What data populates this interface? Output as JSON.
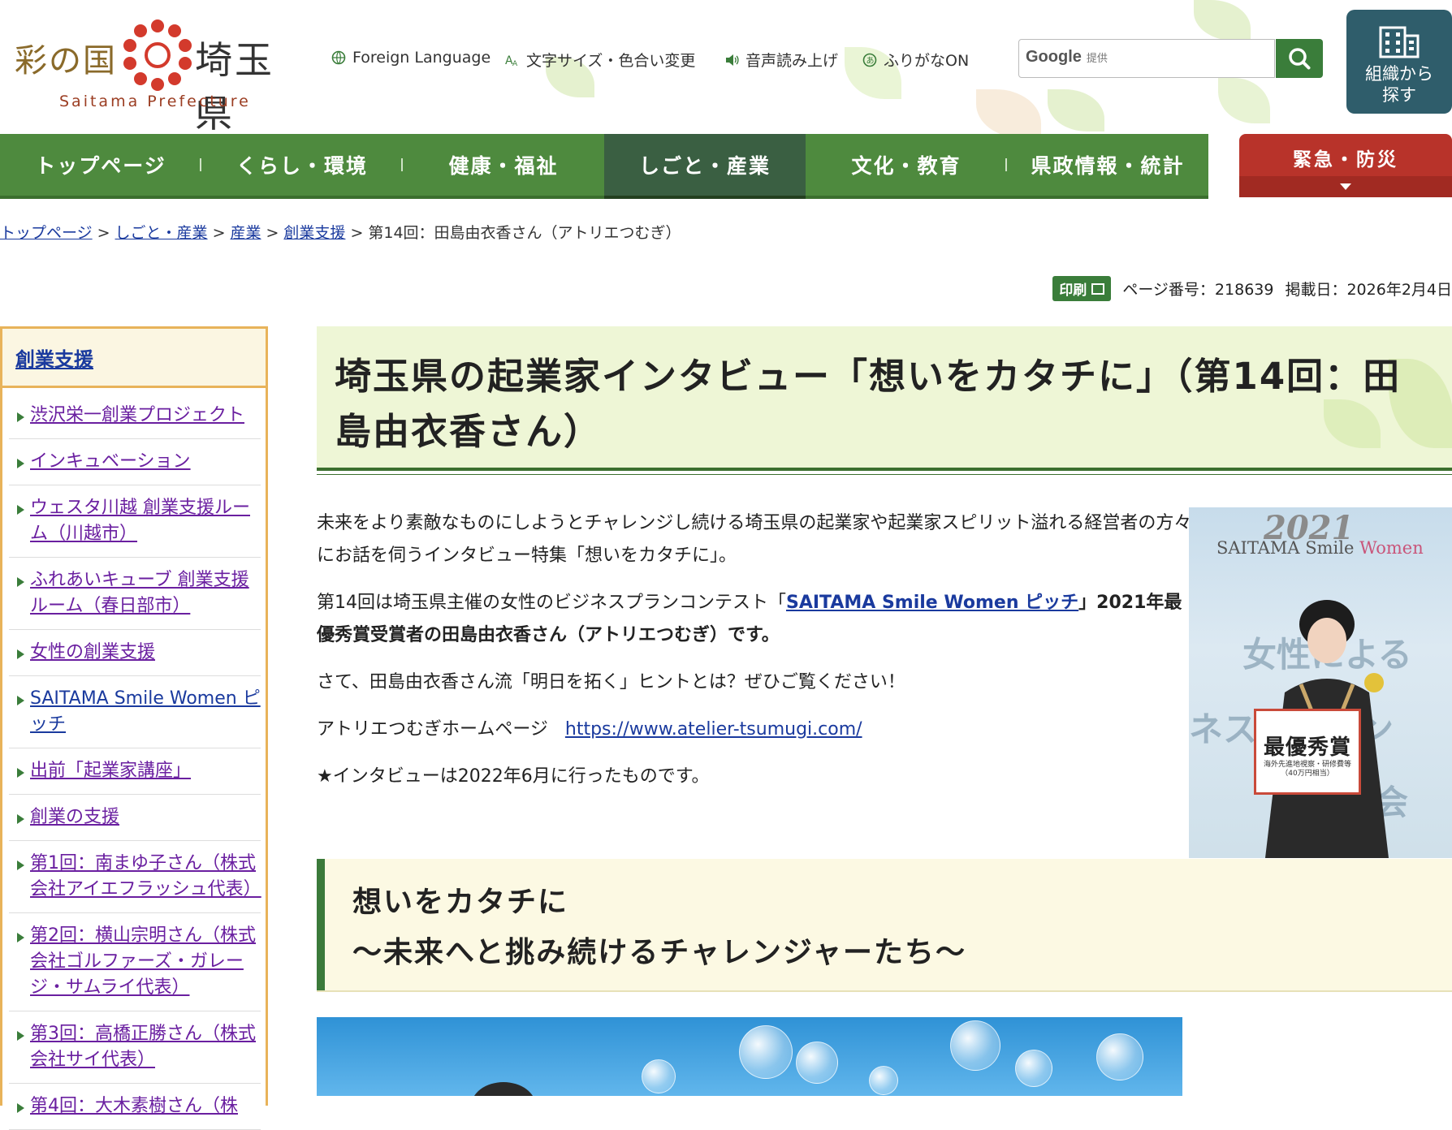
{
  "header": {
    "logo_sainokuni": "彩の国",
    "logo_name": "埼玉県",
    "logo_en": "Saitama Prefecture",
    "utility_links": [
      {
        "label": "Foreign Language",
        "icon": "globe-icon"
      },
      {
        "label": "文字サイズ・色合い変更",
        "icon": "text-size-icon"
      },
      {
        "label": "音声読み上げ",
        "icon": "speaker-icon"
      },
      {
        "label": "ふりがなON",
        "icon": "furigana-icon"
      }
    ],
    "search": {
      "brand": "Google",
      "brand_suffix": "提供"
    },
    "org_button": "組織から探す"
  },
  "nav": {
    "items": [
      "トップページ",
      "くらし・環境",
      "健康・福祉",
      "しごと・産業",
      "文化・教育",
      "県政情報・統計"
    ],
    "active_index": 3,
    "emergency": "緊急・防災"
  },
  "breadcrumb": {
    "items": [
      "トップページ",
      "しごと・産業",
      "産業",
      "創業支援"
    ],
    "current": "第14回：田島由衣香さん（アトリエつむぎ）",
    "separator": ">"
  },
  "meta": {
    "print_label": "印刷",
    "page_number": "ページ番号：218639",
    "published": "掲載日：2026年2月4日"
  },
  "sidebar": {
    "heading": "創業支援",
    "items": [
      "渋沢栄一創業プロジェクト",
      "インキュベーション",
      "ウェスタ川越 創業支援ルーム（川越市）",
      "ふれあいキューブ 創業支援ルーム（春日部市）",
      "女性の創業支援",
      "SAITAMA Smile Women ピッチ",
      "出前「起業家講座」",
      "創業の支援",
      "第1回：南まゆ子さん（株式会社アイエフラッシュ代表）",
      "第2回：横山宗明さん（株式会社ゴルファーズ・ガレージ・サムライ代表）",
      "第3回：高橋正勝さん（株式会社サイ代表）",
      "第4回：大木素樹さん（株"
    ]
  },
  "main": {
    "title": "埼玉県の起業家インタビュー「想いをカタチに」（第14回：田島由衣香さん）",
    "intro": "未来をより素敵なものにしようとチャレンジし続ける埼玉県の起業家や起業家スピリット溢れる経営者の方々にお話を伺うインタビュー特集「想いをカタチに」。",
    "p2_pre": "第14回は埼玉県主催の女性のビジネスプランコンテスト「",
    "p2_link": "SAITAMA Smile Women ピッチ",
    "p2_post": "」2021年最優秀賞受賞者の田島由衣香さん（アトリエつむぎ）です。",
    "p3": "さて、田島由衣香さん流「明日を拓く」ヒントとは？ぜひご覧ください！",
    "hp_label": "アトリエつむぎホームページ",
    "hp_url": "https://www.atelier-tsumugi.com/",
    "note": "★インタビューは2022年6月に行ったものです。",
    "photo": {
      "year": "2021",
      "sub_a": "SAITAMA Smile ",
      "sub_b": "Women",
      "bg1": "女性による",
      "bg2": "ネス　　コン",
      "bg3": "会",
      "award": "最優秀賞",
      "award_note": "海外先進地視察・研修費等（40万円相当）"
    },
    "catch_line1": "想いをカタチに",
    "catch_line2": "～未来へと挑み続けるチャレンジャーたち～"
  }
}
